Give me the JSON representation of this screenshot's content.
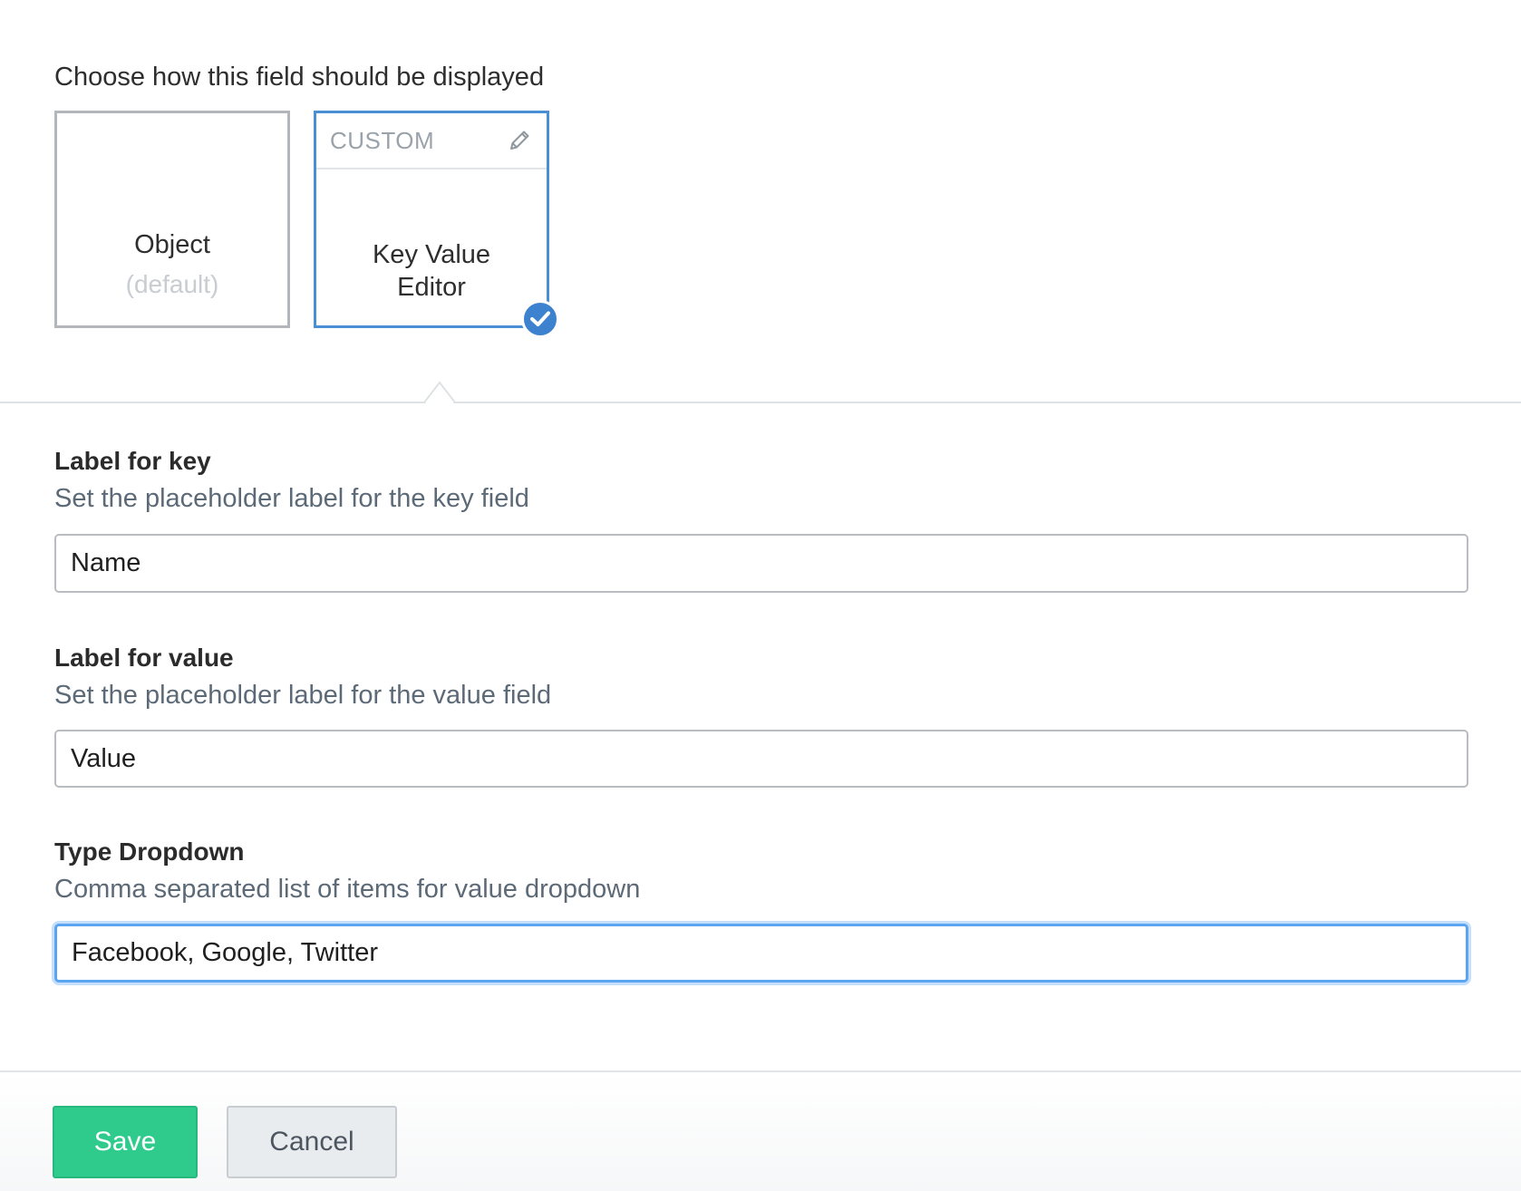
{
  "display": {
    "prompt": "Choose how this field should be displayed",
    "options": [
      {
        "name": "Object",
        "sub": "(default)",
        "selected": false
      },
      {
        "tag": "CUSTOM",
        "name_line1": "Key Value",
        "name_line2": "Editor",
        "selected": true
      }
    ]
  },
  "fields": [
    {
      "title": "Label for key",
      "description": "Set the placeholder label for the key field",
      "value": "Name"
    },
    {
      "title": "Label for value",
      "description": "Set the placeholder label for the value field",
      "value": "Value"
    },
    {
      "title": "Type Dropdown",
      "description": "Comma separated list of items for value dropdown",
      "value": "Facebook, Google, Twitter",
      "focused": true
    }
  ],
  "footer": {
    "save_label": "Save",
    "cancel_label": "Cancel"
  },
  "colors": {
    "selected_border": "#4a8fd6",
    "save_green": "#2ecb8c",
    "focus_blue": "#5aa4f2"
  },
  "icons": {
    "edit": "pencil-icon",
    "selected": "checkmark-icon"
  }
}
